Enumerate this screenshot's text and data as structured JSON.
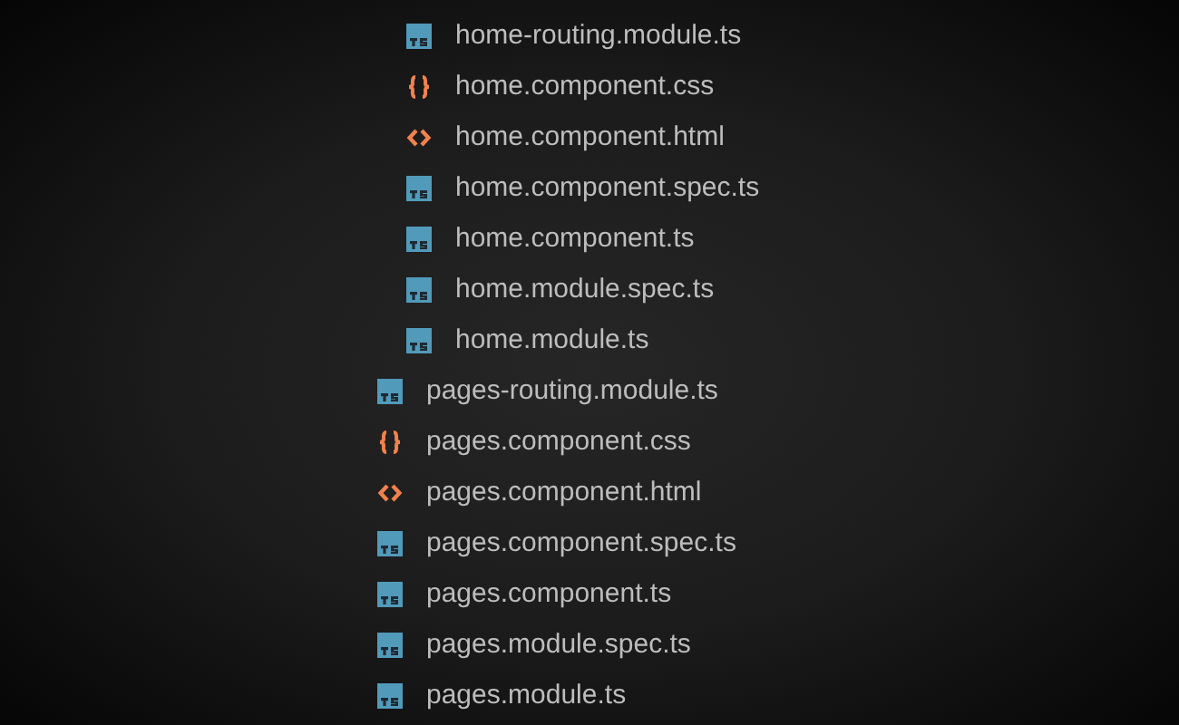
{
  "tree": [
    {
      "children": [
        {
          "kind": "ts",
          "label": "home-routing.module.ts"
        },
        {
          "kind": "css",
          "label": "home.component.css"
        },
        {
          "kind": "html",
          "label": "home.component.html"
        },
        {
          "kind": "ts",
          "label": "home.component.spec.ts"
        },
        {
          "kind": "ts",
          "label": "home.component.ts"
        },
        {
          "kind": "ts",
          "label": "home.module.spec.ts"
        },
        {
          "kind": "ts",
          "label": "home.module.ts"
        }
      ]
    },
    {
      "kind": "ts",
      "label": "pages-routing.module.ts"
    },
    {
      "kind": "css",
      "label": "pages.component.css"
    },
    {
      "kind": "html",
      "label": "pages.component.html"
    },
    {
      "kind": "ts",
      "label": "pages.component.spec.ts"
    },
    {
      "kind": "ts",
      "label": "pages.component.ts"
    },
    {
      "kind": "ts",
      "label": "pages.module.spec.ts"
    },
    {
      "kind": "ts",
      "label": "pages.module.ts"
    }
  ]
}
